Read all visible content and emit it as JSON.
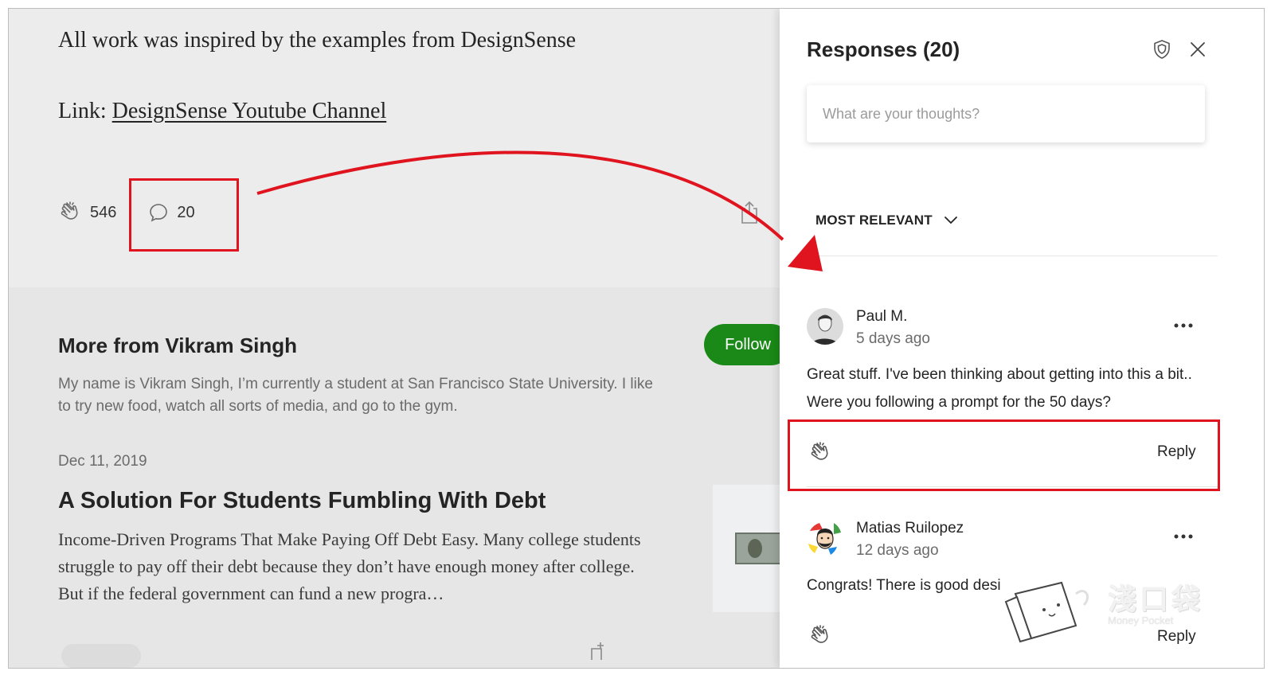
{
  "article": {
    "inspired_text": "All work was inspired by the examples from DesignSense",
    "link_prefix": "Link: ",
    "link_text": "DesignSense Youtube Channel",
    "clap_count": "546",
    "comment_count": "20"
  },
  "more_from": {
    "title": "More from Vikram Singh",
    "follow_label": "Follow",
    "bio": "My name is Vikram Singh, I’m currently a student at San Francisco State University. I like to try new food, watch all sorts of media, and go to the gym."
  },
  "story": {
    "date": "Dec 11, 2019",
    "title": "A Solution For Students Fumbling With Debt",
    "excerpt": "Income-Driven Programs That Make Paying Off Debt Easy. Many college students struggle to pay off their debt because they don’t have enough money after college. But if the federal government can fund a new progra…"
  },
  "responses": {
    "title": "Responses (20)",
    "placeholder": "What are your thoughts?",
    "sort_label": "MOST RELEVANT",
    "items": [
      {
        "author": "Paul M.",
        "ago": "5 days ago",
        "text": "Great stuff. I've been thinking about getting into this a bit.. Were you following a prompt for the 50 days?",
        "reply_label": "Reply"
      },
      {
        "author": "Matias Ruilopez",
        "ago": "12 days ago",
        "text": "Congrats! There is good desi",
        "reply_label": "Reply"
      }
    ]
  },
  "watermark": {
    "cn": "淺口袋",
    "en": "Money Pocket"
  },
  "colors": {
    "highlight": "#e0141e",
    "follow_green": "#1a8917"
  }
}
